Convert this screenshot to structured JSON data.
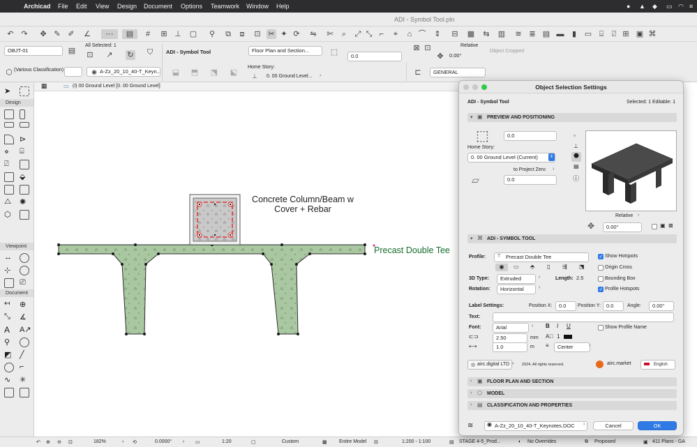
{
  "menubar": {
    "app_name": "Archicad",
    "items": [
      "File",
      "Edit",
      "View",
      "Design",
      "Document",
      "Options",
      "Teamwork",
      "Window",
      "Help"
    ]
  },
  "window": {
    "title": "ADI - Symbol Tool.pln"
  },
  "infobox": {
    "element_id": "OBJT-01",
    "selection": "All Selected: 1",
    "tool_name": "ADI - Symbol Tool",
    "floor_plan_section": "Floor Plan and Section...",
    "offset_value": "0.0",
    "relative_label": "Relative",
    "angle_value": "0.00°",
    "status": "Object Cropped",
    "classification": "(Various Classification)",
    "layer": "A-Zz_20_10_40-T_Keyn...",
    "home_story_label": "Home Story:",
    "home_story_value": "0. 00 Ground Level...",
    "structure": "GENERAL"
  },
  "tab": {
    "label": "(I) 00 Ground Level [0. 00 Ground Level]"
  },
  "toolbox": {
    "sections": [
      "Design",
      "Viewpoint",
      "Document"
    ]
  },
  "canvas": {
    "column_label_line1": "Concrete Column/Beam w",
    "column_label_line2": "Cover + Rebar",
    "tee_label": "Precast Double Tee"
  },
  "statusbar": {
    "zoom": "182%",
    "angle": "0.0000°",
    "scale": "1:20",
    "custom": "Custom",
    "model": "Entire Model",
    "scale2": "1:200 - 1:100",
    "stage": "STAGE 4-5_Prod...",
    "overrides": "No Overrides",
    "status": "Proposed",
    "plans": "411 Plans - GA"
  },
  "dialog": {
    "title": "Object Selection Settings",
    "object_name": "ADI - Symbol Tool",
    "selected_info": "Selected: 1 Editable: 1",
    "preview_header": "PREVIEW AND POSITIONING",
    "offset_top": "0.0",
    "home_story_label": "Home Story:",
    "home_story_value": "0. 00 Ground Level (Current)",
    "to_project_zero": "to Project Zero",
    "offset_bottom": "0.0",
    "relative_label": "Relative",
    "rotation_angle": "0.00°",
    "symbol_header": "ADI - SYMBOL TOOL",
    "profile_label": "Profile:",
    "profile_value": "Precast Double Tee",
    "show_hotspots": "Show Hotspots",
    "origin_cross": "Origin Cross",
    "bounding_box": "Bounding Box",
    "profile_hotspots": "Profile Hotspots",
    "type3d_label": "3D Type:",
    "type3d_value": "Extruded",
    "length_label": "Length:",
    "length_value": "2.5",
    "rotation_label": "Rotation:",
    "rotation_value": "Horizontal",
    "label_settings": "Label Settings:",
    "pos_x_label": "Position X:",
    "pos_x_value": "0.0",
    "pos_y_label": "Position Y:",
    "pos_y_value": "0.0",
    "angle_label": "Angle:",
    "angle_value": "0.00°",
    "text_label": "Text:",
    "font_label": "Font:",
    "font_value": "Arial",
    "show_profile_name": "Show Profile Name",
    "size_value": "2.50",
    "size_unit": "mm",
    "spacing_value": "1.0",
    "spacing_unit": "m",
    "align_value": "Center",
    "vendor": "airc.digital LTD",
    "copyright": "2024. All rights reserved.",
    "market": "airc.market",
    "language": "English",
    "floor_plan_header": "FLOOR PLAN AND SECTION",
    "model_header": "MODEL",
    "classification_header": "CLASSIFICATION AND PROPERTIES",
    "layer_value": "A-Zz_20_10_40-T_Keynotes.DOC",
    "cancel": "Cancel",
    "ok": "OK"
  },
  "colors": {
    "concrete_fill": "#a9c7a1",
    "concrete_stroke": "#2e2e2e",
    "rebar": "#e03a3a",
    "accent": "#2f7ae5",
    "market_orange": "#e8691c"
  }
}
